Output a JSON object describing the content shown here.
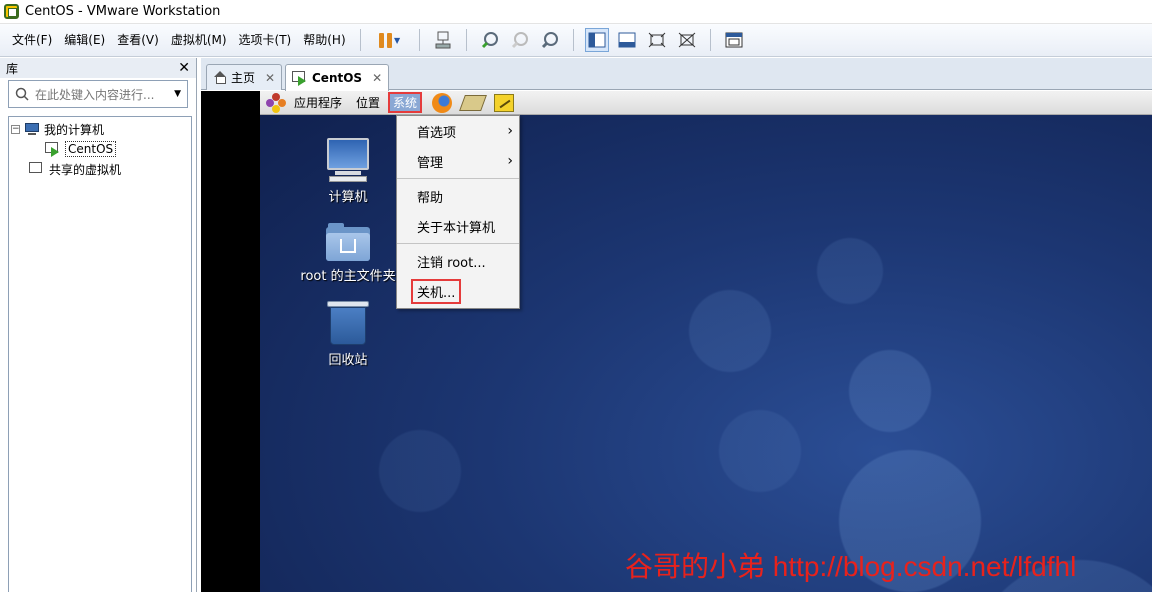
{
  "window": {
    "title": "CentOS - VMware Workstation"
  },
  "menubar": {
    "items": [
      "文件(F)",
      "编辑(E)",
      "查看(V)",
      "虚拟机(M)",
      "选项卡(T)",
      "帮助(H)"
    ]
  },
  "library": {
    "header": "库",
    "close": "✕",
    "search_placeholder": "在此处键入内容进行...",
    "tree": {
      "my_computer": "我的计算机",
      "vm": "CentOS",
      "shared": "共享的虚拟机",
      "expander": "−"
    }
  },
  "tabs": [
    {
      "label": "主页",
      "close": "✕"
    },
    {
      "label": "CentOS",
      "close": "✕"
    }
  ],
  "guest": {
    "panel": {
      "applications": "应用程序",
      "places": "位置",
      "system": "系统"
    },
    "desktop": {
      "computer": "计算机",
      "home": "root 的主文件夹",
      "trash": "回收站"
    },
    "system_menu": {
      "preferences": "首选项",
      "administration": "管理",
      "help": "帮助",
      "about": "关于本计算机",
      "logout": "注销 root...",
      "shutdown": "关机...",
      "submenu_arrow": "›"
    }
  },
  "watermark": "谷哥的小弟 http://blog.csdn.net/lfdfhl",
  "colors": {
    "highlight_box": "#e53b3b",
    "watermark": "#e8221c",
    "desktop_bg": "#1c3672"
  },
  "icons": [
    "vmware-logo-icon",
    "pause-icon",
    "home-icon",
    "vm-play-icon",
    "gnome-foot-icon",
    "firefox-icon",
    "mail-icon",
    "note-icon",
    "computer-icon",
    "home-folder-icon",
    "trash-icon"
  ]
}
